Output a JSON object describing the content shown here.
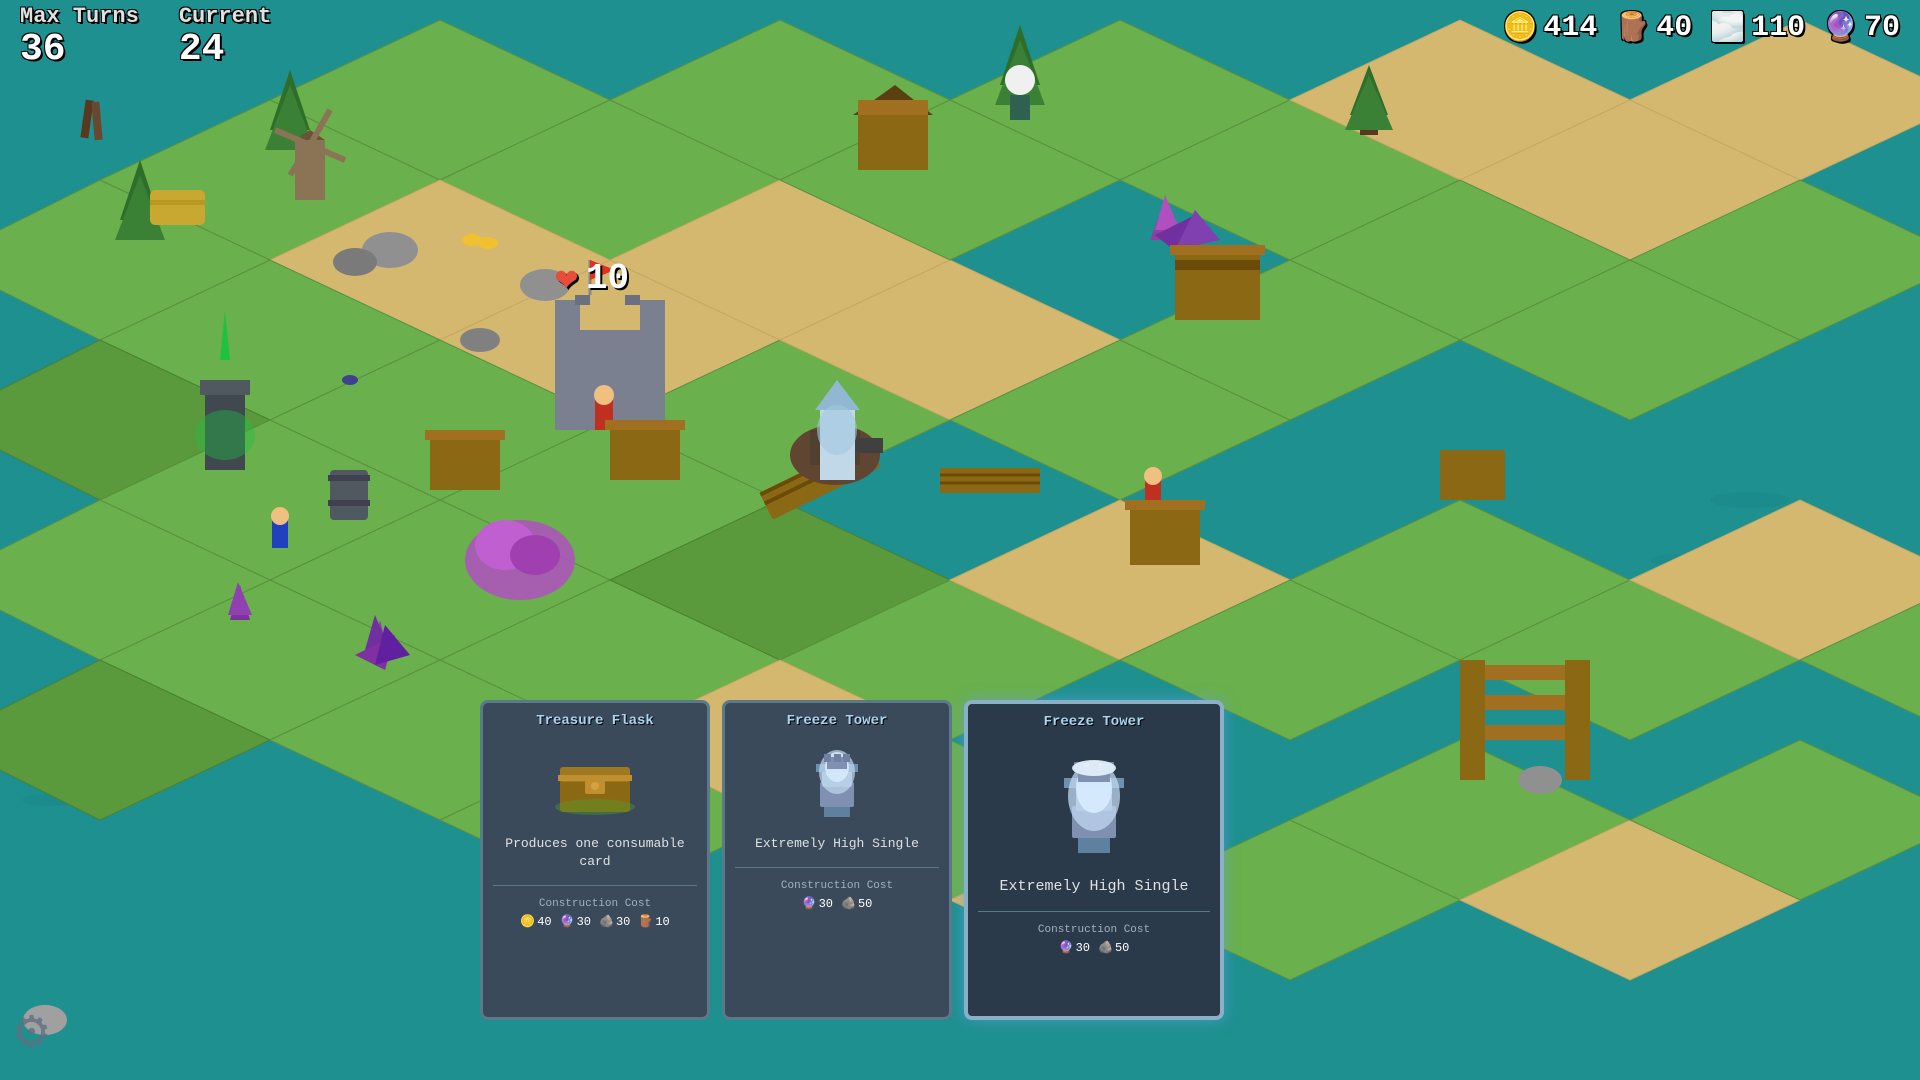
{
  "hud": {
    "turns": {
      "max_label": "Max Turns",
      "max_value": "36",
      "current_label": "Current",
      "current_value": "24"
    },
    "resources": {
      "gold": {
        "icon": "🪙",
        "value": "414"
      },
      "wood": {
        "icon": "🪵",
        "value": "40"
      },
      "stone": {
        "icon": "💎",
        "value": "110"
      },
      "magic": {
        "icon": "🔮",
        "value": "70"
      }
    },
    "health": {
      "icon": "❤",
      "value": "10"
    }
  },
  "cards": [
    {
      "id": "treasure-flask",
      "title": "Treasure Flask",
      "description": "Produces one consumable card",
      "cost_label": "Construction Cost",
      "costs": [
        {
          "icon": "🪙",
          "value": "40"
        },
        {
          "icon": "🔮",
          "value": "30"
        },
        {
          "icon": "🪨",
          "value": "30"
        },
        {
          "icon": "🪵",
          "value": "10"
        }
      ],
      "selected": false
    },
    {
      "id": "freeze-tower-1",
      "title": "Freeze Tower",
      "description": "Extremely High\nSingle",
      "cost_label": "Construction Cost",
      "costs": [
        {
          "icon": "🔮",
          "value": "30"
        },
        {
          "icon": "🪨",
          "value": "50"
        }
      ],
      "selected": false
    },
    {
      "id": "freeze-tower-2",
      "title": "Freeze Tower",
      "description": "Extremely High\nSingle",
      "cost_label": "Construction Cost",
      "costs": [
        {
          "icon": "🔮",
          "value": "30"
        },
        {
          "icon": "🪨",
          "value": "50"
        }
      ],
      "selected": true
    }
  ],
  "icons": {
    "gear": "⚙",
    "heart": "❤"
  }
}
